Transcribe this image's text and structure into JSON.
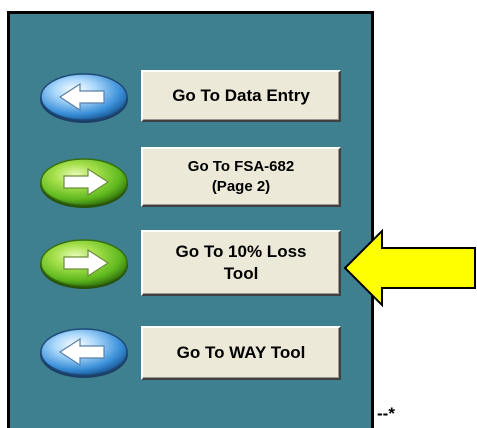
{
  "buttons": [
    {
      "label": "Go To Data Entry",
      "icon": "back-arrow-blue",
      "icon_color": "#3a8fd8"
    },
    {
      "label": "Go To FSA-682\n(Page 2)",
      "icon": "forward-arrow-green",
      "icon_color": "#5fb81e"
    },
    {
      "label": "Go To 10% Loss\nTool",
      "icon": "forward-arrow-green",
      "icon_color": "#5fb81e"
    },
    {
      "label": "Go To WAY Tool",
      "icon": "back-arrow-blue",
      "icon_color": "#3a8fd8"
    }
  ],
  "callout": {
    "icon": "yellow-pointer-arrow",
    "color": "#ffff00"
  },
  "footer_mark": "--*",
  "colors": {
    "panel_bg": "#3e8090",
    "button_bg": "#ece9d8"
  }
}
